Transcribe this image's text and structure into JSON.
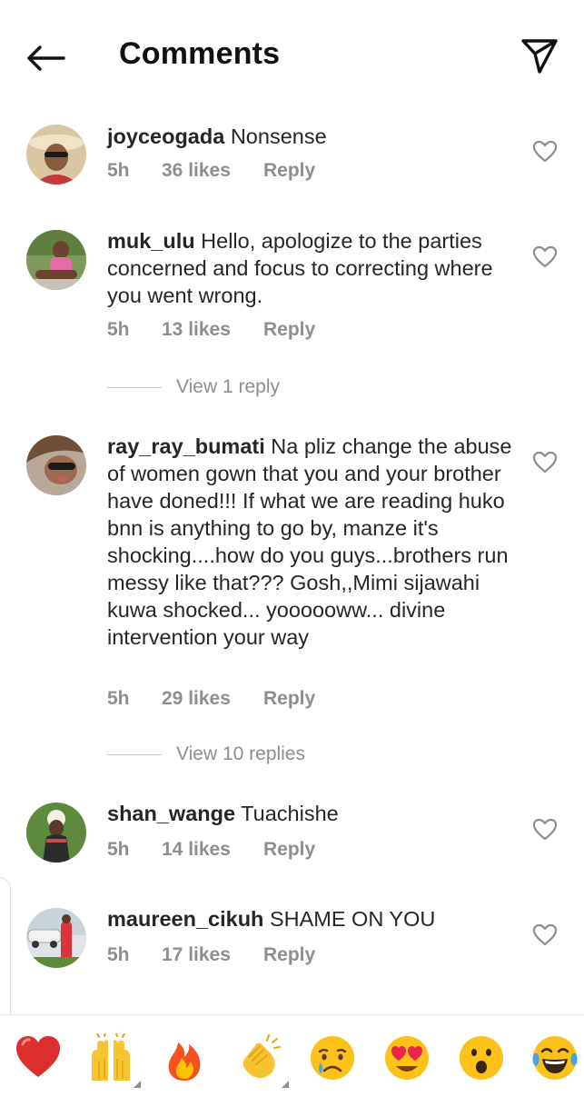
{
  "header": {
    "title": "Comments",
    "back_icon": "arrow-left-icon",
    "share_icon": "paper-plane-icon"
  },
  "comments": [
    {
      "username": "joyceogada",
      "text": "Nonsense",
      "time": "5h",
      "likes": "36 likes",
      "reply": "Reply"
    },
    {
      "username": "muk_ulu",
      "text": "Hello, apologize to the parties concerned and focus to correcting where you went wrong.",
      "time": "5h",
      "likes": "13 likes",
      "reply": "Reply",
      "view_replies": "View 1 reply"
    },
    {
      "username": "ray_ray_bumati",
      "text": "Na pliz change the abuse of women gown that you and your brother have doned!!! If what we are reading huko bnn is anything to go by, manze it's shocking....how do you guys...brothers run messy like that??? Gosh,,Mimi sijawahi kuwa shocked... yoooooww... divine intervention your way",
      "time": "5h",
      "likes": "29 likes",
      "reply": "Reply",
      "view_replies": "View 10 replies"
    },
    {
      "username": "shan_wange",
      "text": "Tuachishe",
      "time": "5h",
      "likes": "14 likes",
      "reply": "Reply"
    },
    {
      "username": "maureen_cikuh",
      "text": "SHAME ON YOU",
      "time": "5h",
      "likes": "17 likes",
      "reply": "Reply"
    }
  ],
  "emoji_bar": [
    {
      "name": "red-heart-emoji",
      "glyph": "❤️"
    },
    {
      "name": "raising-hands-emoji",
      "glyph": "🙌"
    },
    {
      "name": "fire-emoji",
      "glyph": "🔥"
    },
    {
      "name": "clapping-hands-emoji",
      "glyph": "👏"
    },
    {
      "name": "crying-face-emoji",
      "glyph": "😢"
    },
    {
      "name": "heart-eyes-emoji",
      "glyph": "😍"
    },
    {
      "name": "surprised-face-emoji",
      "glyph": "😮"
    },
    {
      "name": "tears-of-joy-emoji",
      "glyph": "😂"
    }
  ],
  "colors": {
    "text": "#262626",
    "meta": "#8e8e8e",
    "heart_outline": "#8e8e8e"
  }
}
